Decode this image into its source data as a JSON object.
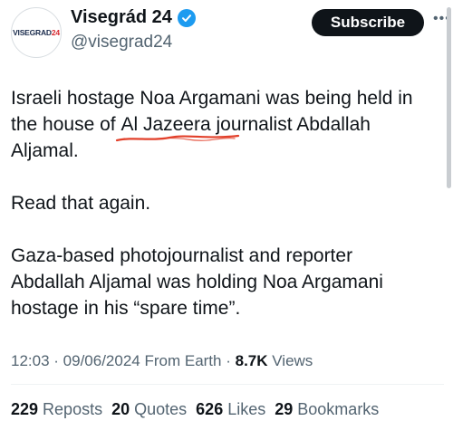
{
  "account": {
    "avatar_text_main": "VISEGRAD",
    "avatar_text_suffix": "24",
    "display_name": "Visegrád 24",
    "handle": "@visegrad24",
    "verified_icon": "verified-badge-icon",
    "subscribe_label": "Subscribe",
    "more_icon": "more-options-icon"
  },
  "tweet": {
    "line1": "Israeli hostage Noa Argamani was being held in",
    "line2_before": "the house of ",
    "line2_highlight": "Al Jazeera",
    "line2_after": " journalist Abdallah",
    "line3": "Aljamal.",
    "para2": "Read that again.",
    "para3_line1": "Gaza-based photojournalist and reporter",
    "para3_line2": "Abdallah Aljamal was holding Noa Argamani",
    "para3_line3": "hostage in his “spare time”."
  },
  "meta": {
    "time": "12:03",
    "sep1": " · ",
    "date": "09/06/2024",
    "source": " From Earth",
    "sep2": " · ",
    "views_count": "8.7K",
    "views_label": " Views"
  },
  "stats": {
    "reposts_count": "229",
    "reposts_label": " Reposts",
    "quotes_count": "20",
    "quotes_label": " Quotes",
    "likes_count": "626",
    "likes_label": " Likes",
    "bookmarks_count": "29",
    "bookmarks_label": " Bookmarks"
  },
  "colors": {
    "verified": "#1d9bf0",
    "annotation_underline": "#e2402a",
    "secondary_text": "#536471"
  }
}
